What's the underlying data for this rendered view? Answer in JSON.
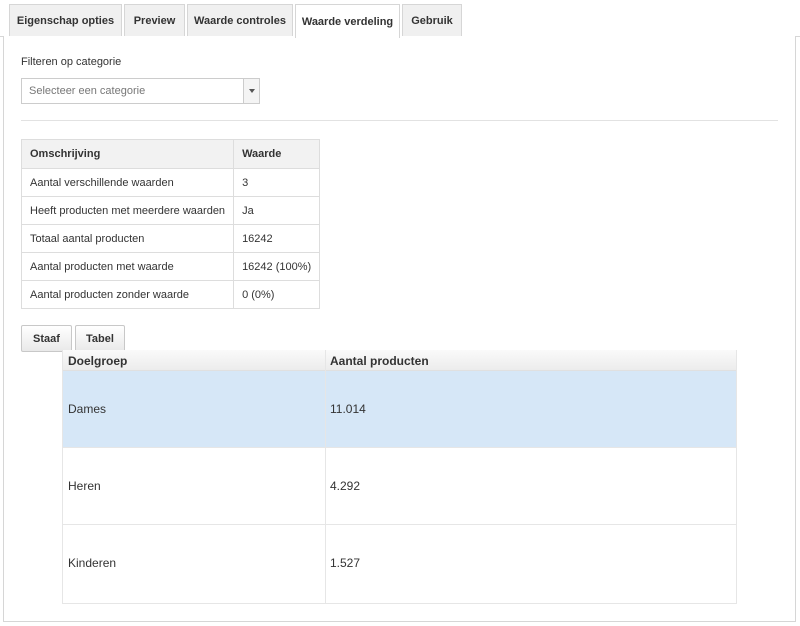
{
  "tabs": [
    {
      "label": "Eigenschap opties",
      "active": false
    },
    {
      "label": "Preview",
      "active": false
    },
    {
      "label": "Waarde controles",
      "active": false
    },
    {
      "label": "Waarde verdeling",
      "active": true
    },
    {
      "label": "Gebruik",
      "active": false
    }
  ],
  "filter": {
    "label": "Filteren op categorie",
    "placeholder": "Selecteer een categorie"
  },
  "stats": {
    "headers": [
      "Omschrijving",
      "Waarde"
    ],
    "rows": [
      [
        "Aantal verschillende waarden",
        "3"
      ],
      [
        "Heeft producten met meerdere waarden",
        "Ja"
      ],
      [
        "Totaal aantal producten",
        "16242"
      ],
      [
        "Aantal producten met waarde",
        "16242 (100%)"
      ],
      [
        "Aantal producten zonder waarde",
        "0 (0%)"
      ]
    ]
  },
  "view_buttons": {
    "bar": "Staaf",
    "table": "Tabel"
  },
  "distribution": {
    "headers": [
      "Doelgroep",
      "Aantal producten"
    ],
    "rows": [
      {
        "group": "Dames",
        "count": "11.014",
        "selected": true
      },
      {
        "group": "Heren",
        "count": "4.292",
        "selected": false
      },
      {
        "group": "Kinderen",
        "count": "1.527",
        "selected": false
      }
    ],
    "selected_color": "#d6e7f7"
  }
}
